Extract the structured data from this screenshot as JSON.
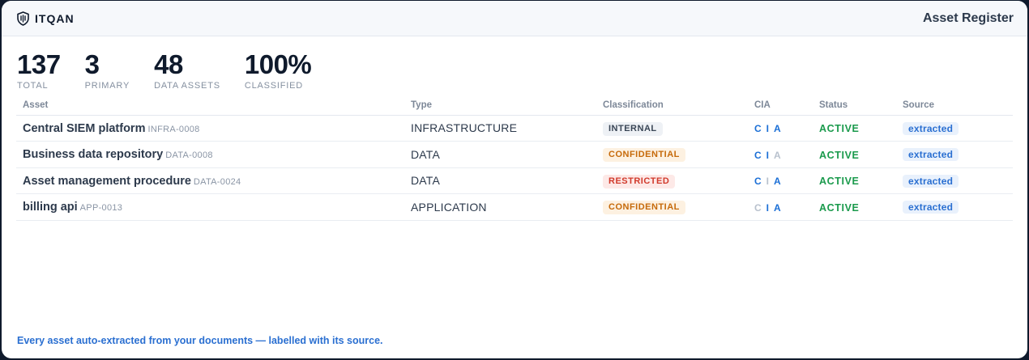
{
  "header": {
    "brand": "ITQAN",
    "title": "Asset Register"
  },
  "stats": [
    {
      "value": "137",
      "label": "TOTAL"
    },
    {
      "value": "3",
      "label": "PRIMARY"
    },
    {
      "value": "48",
      "label": "DATA ASSETS"
    },
    {
      "value": "100%",
      "label": "CLASSIFIED"
    }
  ],
  "table": {
    "columns": [
      "Asset",
      "Type",
      "Classification",
      "CIA",
      "Status",
      "Source"
    ],
    "rows": [
      {
        "name": "Central SIEM platform",
        "id": "INFRA-0008",
        "type": "INFRASTRUCTURE",
        "classification": "INTERNAL",
        "cls_style": "internal",
        "cia": [
          {
            "letter": "C",
            "on": true
          },
          {
            "letter": "I",
            "on": true
          },
          {
            "letter": "A",
            "on": true
          }
        ],
        "status": "ACTIVE",
        "source": "extracted"
      },
      {
        "name": "Business data repository",
        "id": "DATA-0008",
        "type": "DATA",
        "classification": "CONFIDENTIAL",
        "cls_style": "confidential",
        "cia": [
          {
            "letter": "C",
            "on": true
          },
          {
            "letter": "I",
            "on": true
          },
          {
            "letter": "A",
            "on": false
          }
        ],
        "status": "ACTIVE",
        "source": "extracted"
      },
      {
        "name": "Asset management procedure",
        "id": "DATA-0024",
        "type": "DATA",
        "classification": "RESTRICTED",
        "cls_style": "restricted",
        "cia": [
          {
            "letter": "C",
            "on": true
          },
          {
            "letter": "I",
            "on": false
          },
          {
            "letter": "A",
            "on": true
          }
        ],
        "status": "ACTIVE",
        "source": "extracted"
      },
      {
        "name": "billing api",
        "id": "APP-0013",
        "type": "APPLICATION",
        "classification": "CONFIDENTIAL",
        "cls_style": "confidential",
        "cia": [
          {
            "letter": "C",
            "on": false
          },
          {
            "letter": "I",
            "on": true
          },
          {
            "letter": "A",
            "on": true
          }
        ],
        "status": "ACTIVE",
        "source": "extracted"
      }
    ]
  },
  "footer": {
    "text": "Every asset auto-extracted from your documents — labelled with its source."
  },
  "colors": {
    "accent": "#2a6fd1",
    "active": "#1a9a4c",
    "confidential": "#c66a0a",
    "restricted": "#d13a2c"
  },
  "icons": {
    "brand": "shield-logo-icon"
  }
}
